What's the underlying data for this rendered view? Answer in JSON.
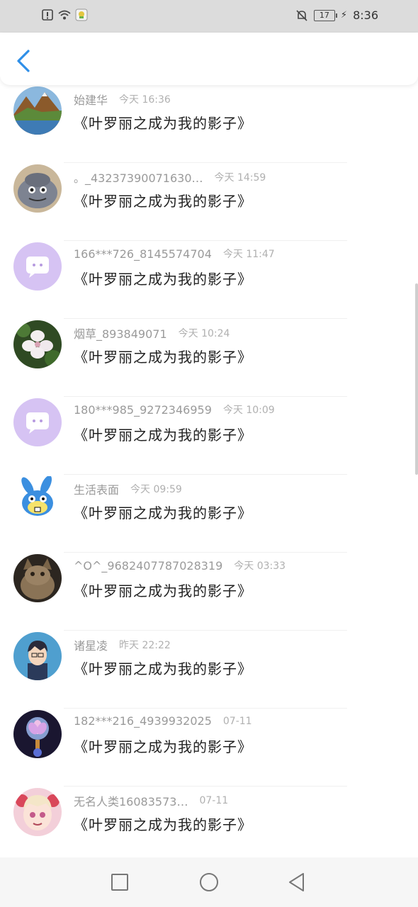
{
  "status_bar": {
    "battery": "17",
    "time": "8:36"
  },
  "header": {
    "back_icon": "chevron-left-icon"
  },
  "items": [
    {
      "name": "始建华",
      "date": "今天 16:36",
      "content": "《叶罗丽之成为我的影子》",
      "avatar": "mountain-lake"
    },
    {
      "name": "。_43237390071630…",
      "date": "今天 14:59",
      "content": "《叶罗丽之成为我的影子》",
      "avatar": "blob-creature"
    },
    {
      "name": "166***726_8145574704",
      "date": "今天 11:47",
      "content": "《叶罗丽之成为我的影子》",
      "avatar": "default-chat"
    },
    {
      "name": "烟草_893849071",
      "date": "今天 10:24",
      "content": "《叶罗丽之成为我的影子》",
      "avatar": "white-flower"
    },
    {
      "name": "180***985_9272346959",
      "date": "今天 10:09",
      "content": "《叶罗丽之成为我的影子》",
      "avatar": "default-chat"
    },
    {
      "name": "生活表面",
      "date": "今天 09:59",
      "content": "《叶罗丽之成为我的影子》",
      "avatar": "blue-rabbit"
    },
    {
      "name": "^O^_9682407787028319",
      "date": "今天 03:33",
      "content": "《叶罗丽之成为我的影子》",
      "avatar": "cat"
    },
    {
      "name": "诸星凌",
      "date": "昨天 22:22",
      "content": "《叶罗丽之成为我的影子》",
      "avatar": "anime-boy"
    },
    {
      "name": "182***216_4939932025",
      "date": "07-11",
      "content": "《叶罗丽之成为我的影子》",
      "avatar": "crystal-flower"
    },
    {
      "name": "无名人类16083573…",
      "date": "07-11",
      "content": "《叶罗丽之成为我的影子》",
      "avatar": "anime-girl"
    }
  ],
  "nav": {
    "recent_icon": "square-icon",
    "home_icon": "circle-icon",
    "back_icon": "triangle-back-icon"
  },
  "colors": {
    "accent": "#2f8fe8",
    "default_avatar": "#d6c3f3"
  }
}
